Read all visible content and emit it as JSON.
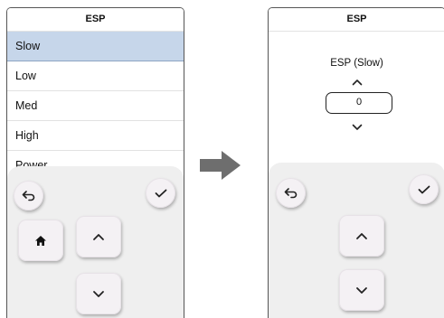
{
  "left_screen": {
    "title": "ESP",
    "items": [
      {
        "label": "Slow",
        "selected": true
      },
      {
        "label": "Low",
        "selected": false
      },
      {
        "label": "Med",
        "selected": false
      },
      {
        "label": "High",
        "selected": false
      },
      {
        "label": "Power",
        "selected": false
      }
    ]
  },
  "right_screen": {
    "title": "ESP",
    "setting_label": "ESP (Slow)",
    "value": "0"
  },
  "colors": {
    "selection": "#c6d6ea",
    "pad_bg": "#efefef",
    "button_bg": "#f4f1f4",
    "arrow": "#6e6e6e"
  },
  "icons": [
    "back-icon",
    "check-icon",
    "home-icon",
    "chevron-up-icon",
    "chevron-down-icon",
    "right-arrow-icon"
  ]
}
